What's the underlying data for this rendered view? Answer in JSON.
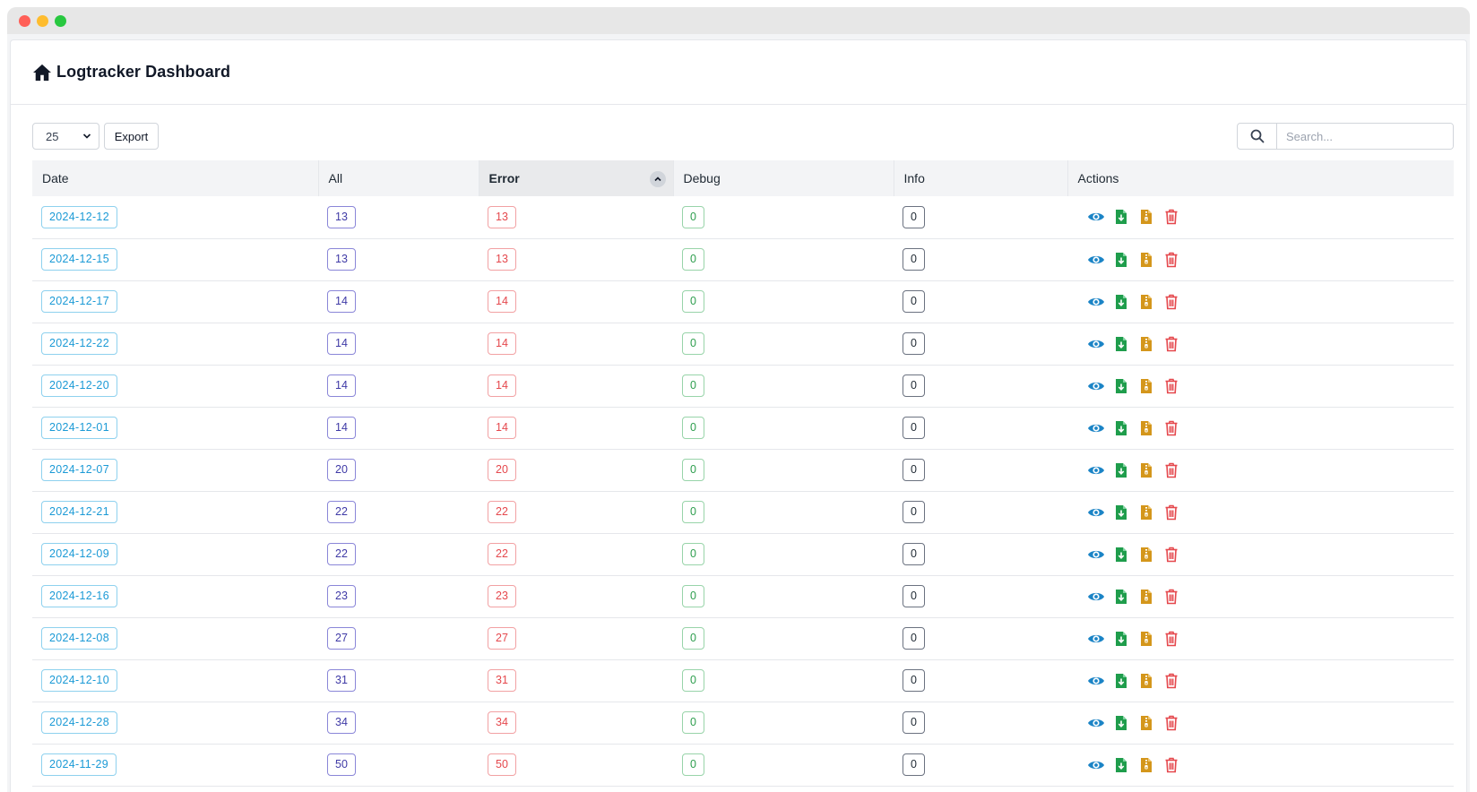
{
  "header": {
    "title": "Logtracker Dashboard",
    "icon": "home-icon"
  },
  "toolbar": {
    "page_size": "25",
    "export_label": "Export",
    "search_placeholder": "Search...",
    "search_icon": "search-icon"
  },
  "table": {
    "columns": [
      "Date",
      "All",
      "Error",
      "Debug",
      "Info",
      "Actions"
    ],
    "sorted_column": "Error",
    "rows": [
      {
        "date": "2024-12-12",
        "all": "13",
        "error": "13",
        "debug": "0",
        "info": "0"
      },
      {
        "date": "2024-12-15",
        "all": "13",
        "error": "13",
        "debug": "0",
        "info": "0"
      },
      {
        "date": "2024-12-17",
        "all": "14",
        "error": "14",
        "debug": "0",
        "info": "0"
      },
      {
        "date": "2024-12-22",
        "all": "14",
        "error": "14",
        "debug": "0",
        "info": "0"
      },
      {
        "date": "2024-12-20",
        "all": "14",
        "error": "14",
        "debug": "0",
        "info": "0"
      },
      {
        "date": "2024-12-01",
        "all": "14",
        "error": "14",
        "debug": "0",
        "info": "0"
      },
      {
        "date": "2024-12-07",
        "all": "20",
        "error": "20",
        "debug": "0",
        "info": "0"
      },
      {
        "date": "2024-12-21",
        "all": "22",
        "error": "22",
        "debug": "0",
        "info": "0"
      },
      {
        "date": "2024-12-09",
        "all": "22",
        "error": "22",
        "debug": "0",
        "info": "0"
      },
      {
        "date": "2024-12-16",
        "all": "23",
        "error": "23",
        "debug": "0",
        "info": "0"
      },
      {
        "date": "2024-12-08",
        "all": "27",
        "error": "27",
        "debug": "0",
        "info": "0"
      },
      {
        "date": "2024-12-10",
        "all": "31",
        "error": "31",
        "debug": "0",
        "info": "0"
      },
      {
        "date": "2024-12-28",
        "all": "34",
        "error": "34",
        "debug": "0",
        "info": "0"
      },
      {
        "date": "2024-11-29",
        "all": "50",
        "error": "50",
        "debug": "0",
        "info": "0"
      }
    ],
    "row_actions": [
      "view-icon",
      "download-icon",
      "archive-icon",
      "delete-icon"
    ]
  },
  "colors": {
    "date": "#1b9ad6",
    "all": "#3f3aa6",
    "error": "#e5484d",
    "debug": "#2e9e4e",
    "view": "#1b84c6",
    "download": "#1f9d4c",
    "archive": "#d4961b",
    "delete": "#e5484d"
  }
}
